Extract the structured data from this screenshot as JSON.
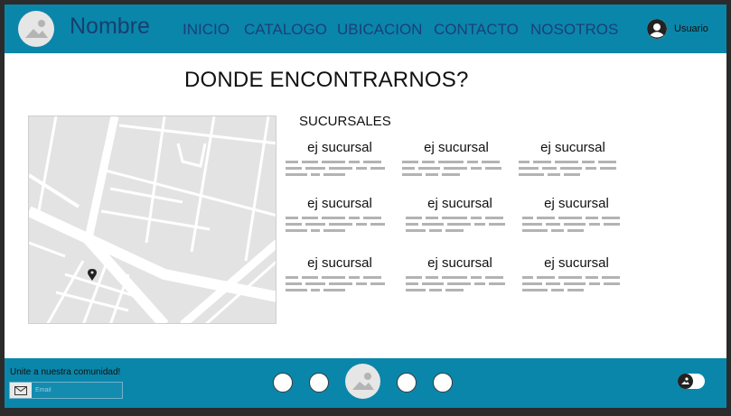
{
  "header": {
    "brand": "Nombre",
    "nav": [
      "INICIO",
      "CATALOGO",
      "UBICACION",
      "CONTACTO",
      "NOSOTROS"
    ],
    "user_label": "Usuario",
    "logo_icon": "image-placeholder-icon",
    "user_icon": "user-avatar-icon"
  },
  "main": {
    "title": "DONDE ENCONTRARNOS?",
    "map_marker_icon": "map-pin-icon",
    "section_label": "SUCURSALES",
    "branches": [
      {
        "name": "ej sucursal"
      },
      {
        "name": "ej sucursal"
      },
      {
        "name": "ej sucursal"
      },
      {
        "name": "ej sucursal"
      },
      {
        "name": "ej sucursal"
      },
      {
        "name": "ej sucursal"
      },
      {
        "name": "ej sucursal"
      },
      {
        "name": "ej sucursal"
      },
      {
        "name": "ej sucursal"
      }
    ]
  },
  "footer": {
    "newsletter_title": "Unite a nuestra comunidad!",
    "email_placeholder": "Email",
    "email_icon": "mail-icon",
    "toggle_icon": "theme-toggle-icon"
  },
  "colors": {
    "primary": "#0a86aa",
    "nav_text": "#1b3f7a",
    "brand_text": "#16406f",
    "placeholder_gray": "#b3b3b3"
  }
}
